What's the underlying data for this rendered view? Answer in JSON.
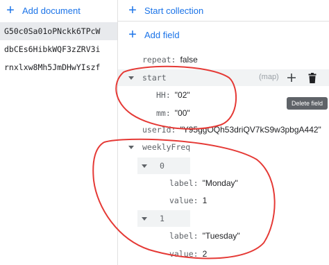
{
  "left": {
    "add_document_label": "Add document",
    "documents": [
      {
        "id": "G50c0Sa01oPNckk6TPcW"
      },
      {
        "id": "dbCEs6HibkWQF3zZRV3i"
      },
      {
        "id": "rnxlxw8Mh5JmDHwYIszf"
      }
    ]
  },
  "right": {
    "start_collection_label": "Start collection",
    "add_field_label": "Add field",
    "fields": {
      "repeat": {
        "key": "repeat",
        "value": "false"
      },
      "start": {
        "key": "start",
        "type": "(map)",
        "hh": {
          "key": "HH",
          "value": "\"02\""
        },
        "mm": {
          "key": "mm",
          "value": "\"00\""
        }
      },
      "userId": {
        "key": "userId",
        "value": "\"Y95ggOQh53driQV7kS9w3pbgA442\""
      },
      "weeklyFreq": {
        "key": "weeklyFreq",
        "items": [
          {
            "index": "0",
            "label_key": "label",
            "label_value": "\"Monday\"",
            "value_key": "value",
            "value_value": "1"
          },
          {
            "index": "1",
            "label_key": "label",
            "label_value": "\"Tuesday\"",
            "value_key": "value",
            "value_value": "2"
          }
        ]
      }
    },
    "tooltip": "Delete field"
  },
  "colors": {
    "accent": "#1a73e8",
    "annotation": "#e53935"
  }
}
